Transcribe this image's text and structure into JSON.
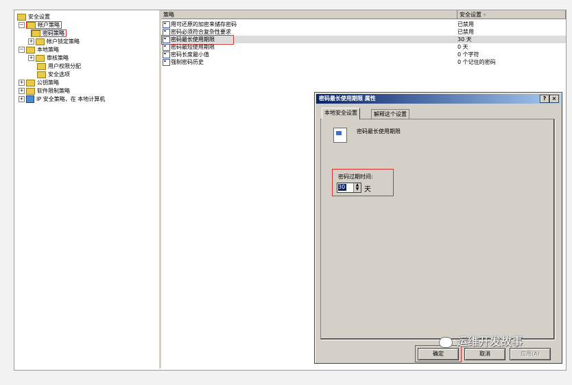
{
  "tree": {
    "root": "安全设置",
    "account_policy": "帐户策略",
    "password_policy": "密码策略",
    "lockout_policy": "帐户锁定策略",
    "local_policy": "本地策略",
    "audit_policy": "审核策略",
    "user_rights": "用户权限分配",
    "security_options": "安全选项",
    "public_key": "公钥策略",
    "software_restriction": "软件限制策略",
    "ip_security": "IP 安全策略，在 本地计算机"
  },
  "list": {
    "col_policy": "策略",
    "col_setting": "安全设置",
    "rows": [
      {
        "policy": "用可还原的加密来储存密码",
        "setting": "已禁用"
      },
      {
        "policy": "密码必须符合复杂性要求",
        "setting": "已禁用"
      },
      {
        "policy": "密码最长使用期限",
        "setting": "30 天"
      },
      {
        "policy": "密码最短使用期限",
        "setting": "0 天"
      },
      {
        "policy": "密码长度最小值",
        "setting": "0 个字符"
      },
      {
        "policy": "强制密码历史",
        "setting": "0 个记住的密码"
      }
    ]
  },
  "dialog": {
    "title": "密码最长使用期限 属性",
    "help_btn": "?",
    "close_btn": "×",
    "tab_local": "本地安全设置",
    "tab_explain": "解释这个设置",
    "heading": "密码最长使用期限",
    "field_label": "密码过期时间:",
    "field_value": "30",
    "unit": "天",
    "ok": "确定",
    "cancel": "取消",
    "apply": "应用(A)"
  },
  "watermark": "运维开发故事"
}
